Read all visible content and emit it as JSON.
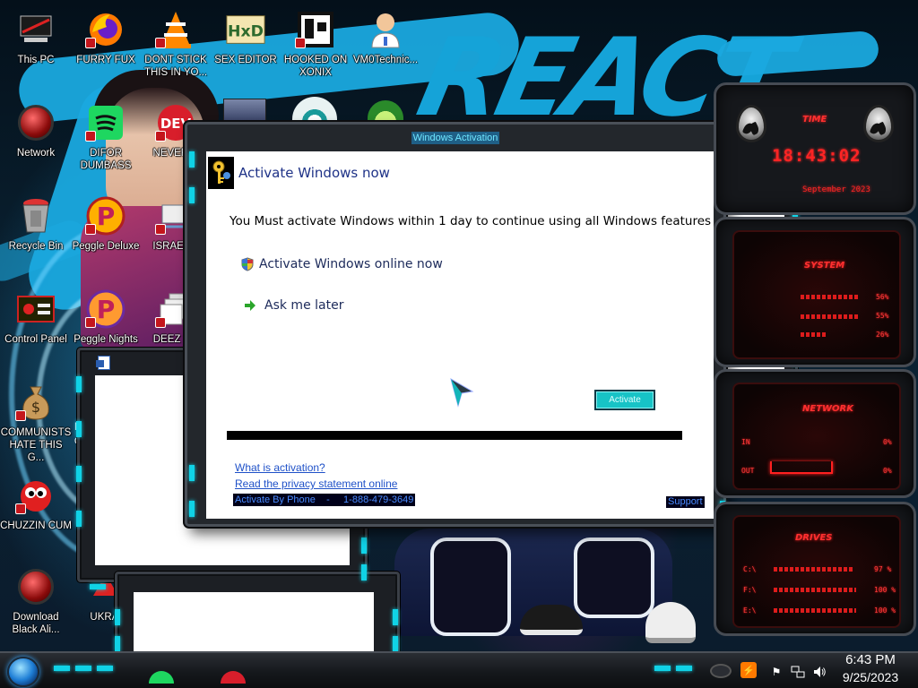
{
  "desktop": {
    "icons": [
      {
        "id": "this-pc",
        "label": "This PC"
      },
      {
        "id": "furry-fux",
        "label": "FURRY FUX"
      },
      {
        "id": "dont-stick",
        "label": "DONT STICK THIS IN YO..."
      },
      {
        "id": "sex-editor",
        "label": "SEX EDITOR"
      },
      {
        "id": "hooked-on-xonix",
        "label": "HOOKED ON XONIX"
      },
      {
        "id": "vm0technic",
        "label": "VM0Technic..."
      },
      {
        "id": "network",
        "label": "Network"
      },
      {
        "id": "difor-dumbass",
        "label": "DIFOR DUMBASS"
      },
      {
        "id": "never-u",
        "label": "NEVER U"
      },
      {
        "id": "recycle-bin",
        "label": "Recycle Bin"
      },
      {
        "id": "peggle-deluxe",
        "label": "Peggle Deluxe"
      },
      {
        "id": "israel-s",
        "label": "ISRAEL S"
      },
      {
        "id": "control-panel",
        "label": "Control Panel"
      },
      {
        "id": "peggle-nights",
        "label": "Peggle Nights"
      },
      {
        "id": "deez-nu",
        "label": "DEEZ NU"
      },
      {
        "id": "communists",
        "label": "COMMUNISTS HATE THIS G..."
      },
      {
        "id": "chuzzin-cum",
        "label": "CHUZZIN CUM"
      },
      {
        "id": "download-black-ali",
        "label": "Download Black Ali..."
      },
      {
        "id": "ukrai",
        "label": "UKRAI"
      }
    ],
    "partial_letters": {
      "ic15_side": "F",
      "ic15_side2": "d"
    },
    "devlogo_text": "DEV"
  },
  "dialog": {
    "title": "Windows Activation",
    "header": "Activate Windows now",
    "message": "You Must activate Windows within 1 day to continue using all Windows features",
    "option_online": "Activate Windows online now",
    "option_later": "Ask me later",
    "activate_button": "Activate",
    "link_what": "What is activation?",
    "link_privacy": "Read the privacy statement online",
    "phone_label": "Activate By Phone    -     1-888-479-3649",
    "support_button": "Support"
  },
  "rainmeter": {
    "time_label": "TIME",
    "time": "18:43:02",
    "date": "September 2023",
    "system_label": "SYSTEM",
    "system_values": [
      "56%",
      "55%",
      "26%"
    ],
    "system_levels": [
      0.56,
      0.55,
      0.26
    ],
    "network_label": "NETWORK",
    "net_in_label": "IN",
    "net_in_value": "0%",
    "net_out_label": "OUT",
    "net_out_value": "0%",
    "drives_label": "DRIVES",
    "drives": [
      {
        "name": "C:\\",
        "value": "97 %",
        "level": 0.97
      },
      {
        "name": "F:\\",
        "value": "100 %",
        "level": 1.0
      },
      {
        "name": "E:\\",
        "value": "100 %",
        "level": 1.0
      }
    ]
  },
  "taskbar": {
    "time": "6:43 PM",
    "date": "9/25/2023"
  },
  "colors": {
    "accent_cyan": "#10d2e6",
    "rainmeter_red": "#ff2424",
    "dialog_header_blue": "#1e3287",
    "link_blue": "#1f51c8"
  }
}
